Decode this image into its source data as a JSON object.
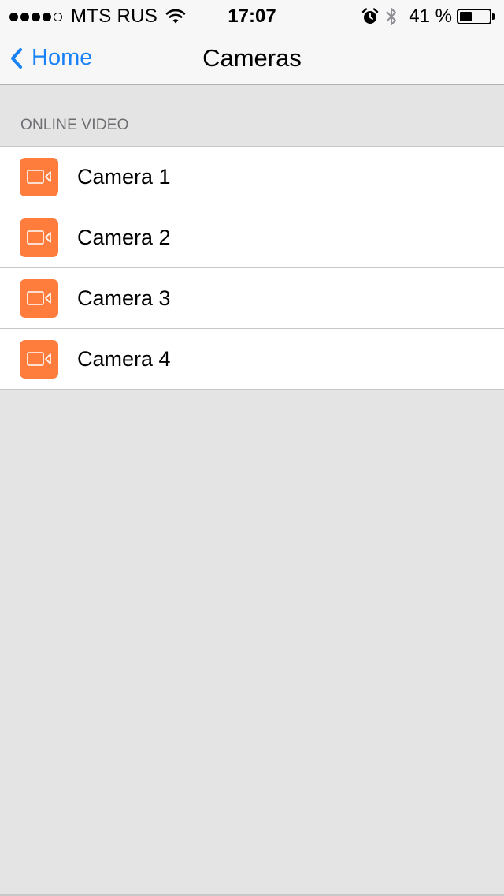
{
  "status_bar": {
    "signal_dots_filled": 4,
    "signal_dots_total": 5,
    "carrier": "MTS RUS",
    "time": "17:07",
    "battery_percent_label": "41 %",
    "battery_level": 0.41,
    "icons": [
      "signal-dots",
      "wifi-icon",
      "alarm-icon",
      "bluetooth-icon",
      "battery-icon"
    ]
  },
  "nav": {
    "back_label": "Home",
    "back_icon": "chevron-left-icon",
    "title": "Cameras"
  },
  "section": {
    "header": "ONLINE VIDEO"
  },
  "cameras": [
    {
      "label": "Camera 1",
      "icon": "video-camera-icon"
    },
    {
      "label": "Camera 2",
      "icon": "video-camera-icon"
    },
    {
      "label": "Camera 3",
      "icon": "video-camera-icon"
    },
    {
      "label": "Camera 4",
      "icon": "video-camera-icon"
    }
  ],
  "colors": {
    "accent": "#1a82f7",
    "camera_icon_bg": "#fe7d3d",
    "background": "#e4e4e4",
    "bar_background": "#f7f7f7"
  }
}
